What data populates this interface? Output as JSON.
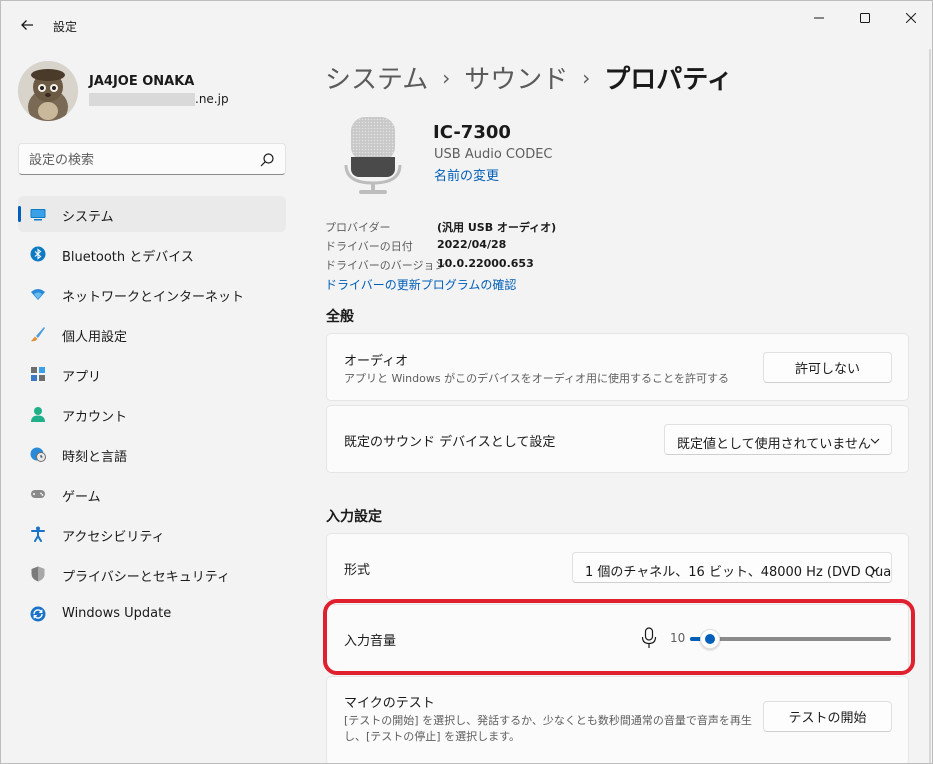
{
  "window": {
    "app_title": "設定",
    "controls": {
      "minimize": "—",
      "maximize": "☐",
      "close": "✕"
    }
  },
  "profile": {
    "name": "JA4JOE ONAKA",
    "email_domain": ".ne.jp"
  },
  "search": {
    "placeholder": "設定の検索"
  },
  "nav": {
    "items": [
      {
        "label": "システム",
        "icon": "system-icon",
        "active": true
      },
      {
        "label": "Bluetooth とデバイス",
        "icon": "bluetooth-icon"
      },
      {
        "label": "ネットワークとインターネット",
        "icon": "network-icon"
      },
      {
        "label": "個人用設定",
        "icon": "personalization-icon"
      },
      {
        "label": "アプリ",
        "icon": "apps-icon"
      },
      {
        "label": "アカウント",
        "icon": "accounts-icon"
      },
      {
        "label": "時刻と言語",
        "icon": "time-language-icon"
      },
      {
        "label": "ゲーム",
        "icon": "gaming-icon"
      },
      {
        "label": "アクセシビリティ",
        "icon": "accessibility-icon"
      },
      {
        "label": "プライバシーとセキュリティ",
        "icon": "privacy-icon"
      },
      {
        "label": "Windows Update",
        "icon": "windows-update-icon"
      }
    ]
  },
  "breadcrumb": {
    "items": [
      "システム",
      "サウンド",
      "プロパティ"
    ],
    "separator": "›"
  },
  "device": {
    "name": "IC-7300",
    "description": "USB Audio CODEC",
    "rename_link": "名前の変更",
    "properties": [
      {
        "key": "プロバイダー",
        "value": "(汎用 USB オーディオ)"
      },
      {
        "key": "ドライバーの日付",
        "value": "2022/04/28"
      },
      {
        "key": "ドライバーのバージョン",
        "value": "10.0.22000.653"
      }
    ],
    "driver_update_link": "ドライバーの更新プログラムの確認"
  },
  "general": {
    "title": "全般",
    "audio": {
      "title": "オーディオ",
      "subtitle": "アプリと Windows がこのデバイスをオーディオ用に使用することを許可する",
      "button": "許可しない"
    },
    "default_device": {
      "title": "既定のサウンド デバイスとして設定",
      "selected": "既定値として使用されていません"
    }
  },
  "input_settings": {
    "title": "入力設定",
    "format": {
      "title": "形式",
      "selected": "1 個のチャネル、16 ビット、48000 Hz (DVD Qua"
    },
    "volume": {
      "title": "入力音量",
      "value": "10",
      "fraction": 0.1
    },
    "mic_test": {
      "title": "マイクのテスト",
      "description_line1": "[テストの開始] を選択し、発話するか、少なくとも数秒間通常の音量で音声を再生",
      "description_line2": "し、[テストの停止] を選択します。",
      "button": "テストの開始"
    }
  },
  "colors": {
    "accent": "#005fb8",
    "highlight": "#e0202e",
    "background": "#f3f3f3",
    "card": "#fbfbfb"
  }
}
